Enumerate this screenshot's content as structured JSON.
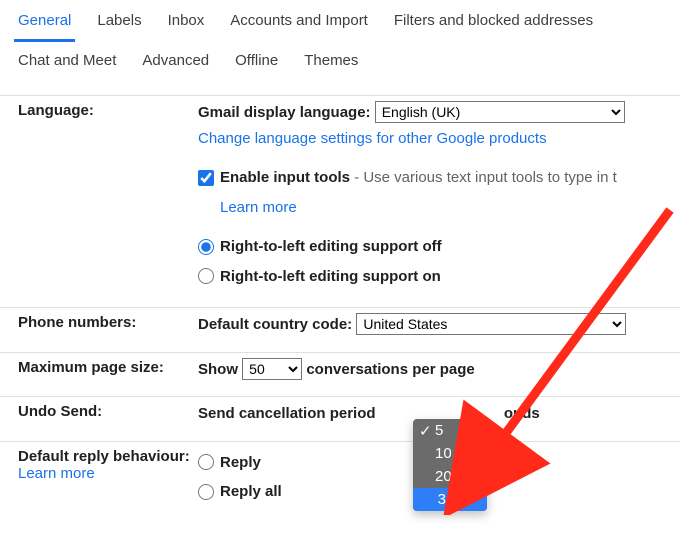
{
  "tabs": {
    "row1": [
      "General",
      "Labels",
      "Inbox",
      "Accounts and Import",
      "Filters and blocked addresses"
    ],
    "row2": [
      "Chat and Meet",
      "Advanced",
      "Offline",
      "Themes"
    ],
    "active": "General"
  },
  "language": {
    "label": "Language:",
    "display_label": "Gmail display language:",
    "display_value": "English (UK)",
    "change_link": "Change language settings for other Google products",
    "input_tools_checked": true,
    "input_tools_label": "Enable input tools",
    "input_tools_desc": " - Use various text input tools to type in t",
    "learn_more": "Learn more",
    "rtl_off": "Right-to-left editing support off",
    "rtl_on": "Right-to-left editing support on",
    "rtl_selected": "off"
  },
  "phone": {
    "label": "Phone numbers:",
    "desc": "Default country code:",
    "value": "United States"
  },
  "pagesize": {
    "label": "Maximum page size:",
    "show": "Show",
    "value": "50",
    "suffix": "conversations per page"
  },
  "undo": {
    "label": "Undo Send:",
    "prefix": "Send cancellation period",
    "suffix": "onds"
  },
  "reply": {
    "label": "Default reply behaviour:",
    "learn_more": "Learn more",
    "reply": "Reply",
    "reply_all": "Reply all"
  },
  "dropdown": {
    "options": [
      "5",
      "10",
      "20",
      "30"
    ],
    "checked": "5",
    "highlighted": "30"
  }
}
